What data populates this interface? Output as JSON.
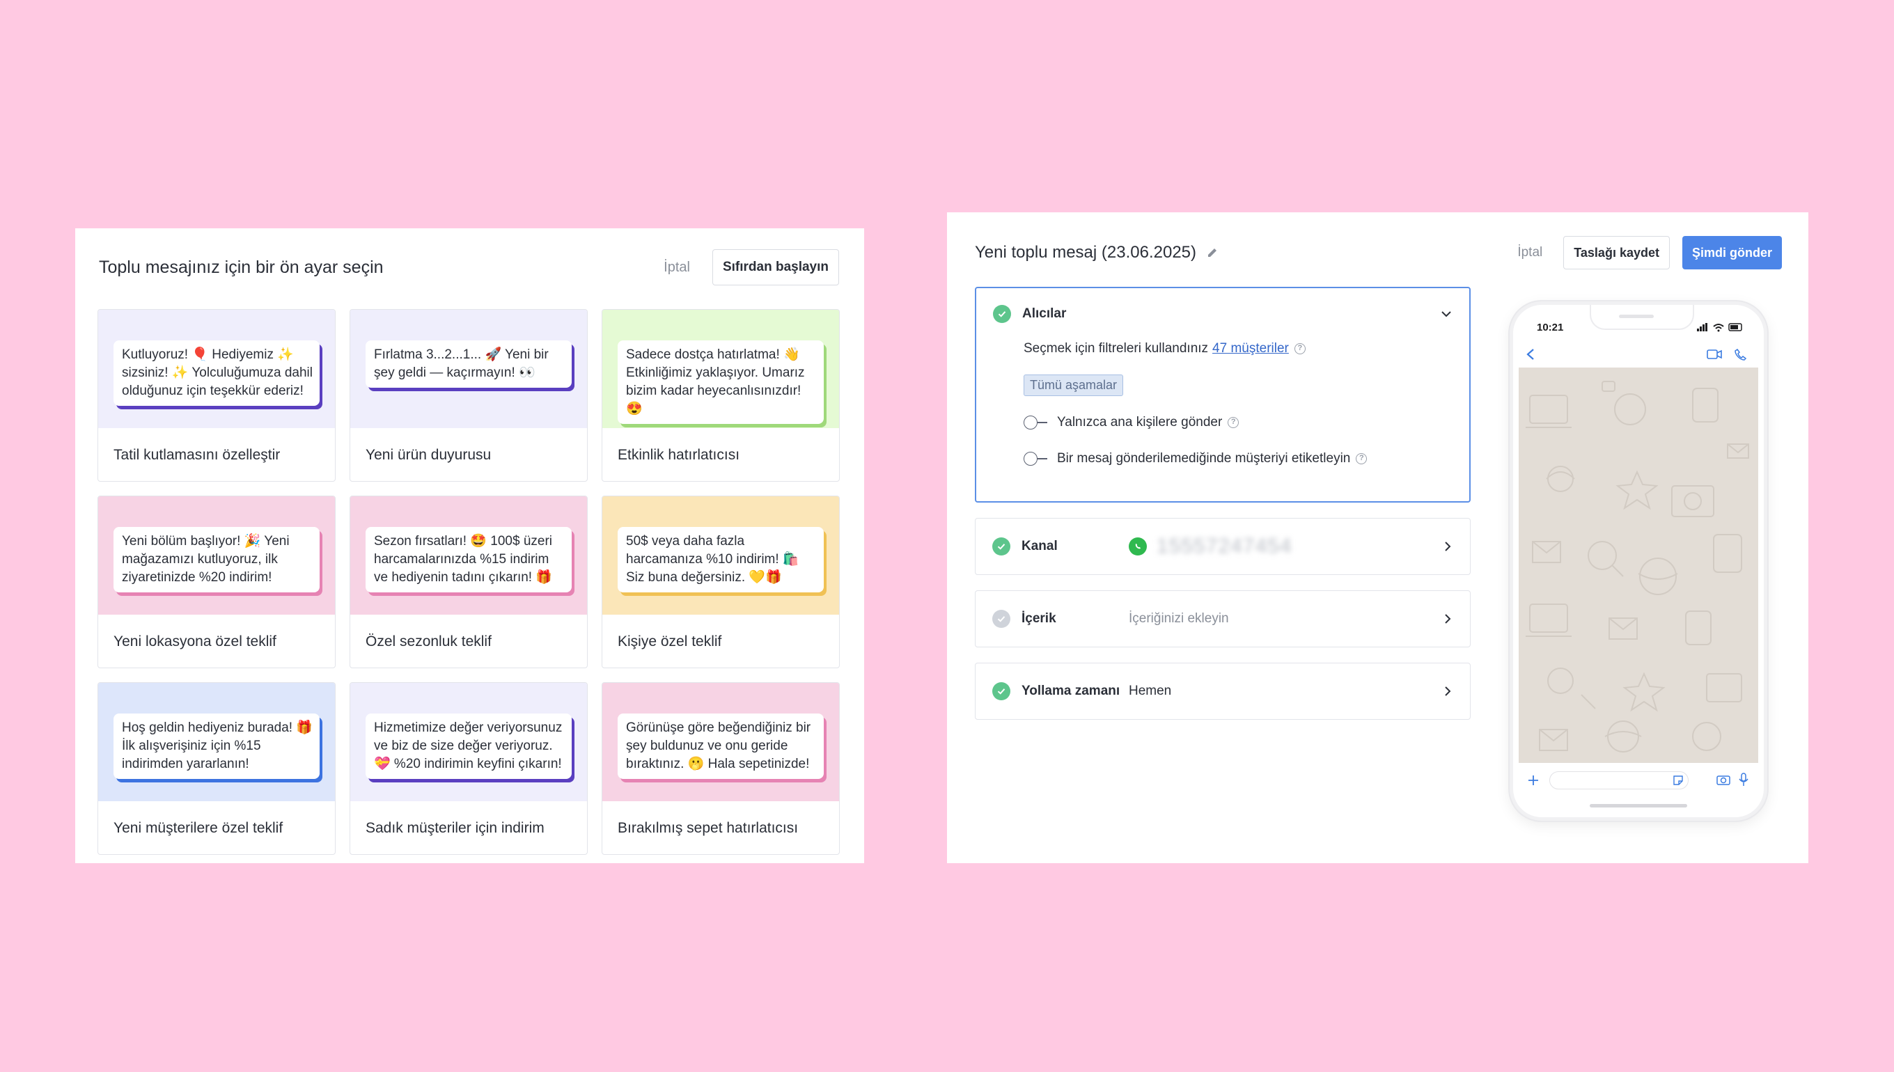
{
  "left": {
    "title": "Toplu mesajınız için bir ön ayar seçin",
    "cancel_label": "İptal",
    "start_blank_label": "Sıfırdan başlayın",
    "cards": [
      {
        "bubble": "Kutluyoruz! 🎈 Hediyemiz ✨ sizsiniz! ✨ Yolculuğumuza dahil olduğunuz için teşekkür ederiz!",
        "label": "Tatil kutlamasını özelleştir",
        "bg": "#efeefc",
        "accent": "#5a3fc0"
      },
      {
        "bubble": "Fırlatma 3...2...1... 🚀 Yeni bir şey geldi — kaçırmayın! 👀",
        "label": "Yeni ürün duyurusu",
        "bg": "#efeefc",
        "accent": "#5a3fc0"
      },
      {
        "bubble": "Sadece dostça hatırlatma! 👋 Etkinliğimiz yaklaşıyor. Umarız bizim kadar heyecanlısınızdır! 😍",
        "label": "Etkinlik hatırlatıcısı",
        "bg": "#e5fad4",
        "accent": "#9fd97a"
      },
      {
        "bubble": "Yeni bölüm başlıyor! 🎉 Yeni mağazamızı kutluyoruz, ilk ziyaretinizde %20 indirim!",
        "label": "Yeni lokasyona özel teklif",
        "bg": "#f7d3e4",
        "accent": "#e683b3"
      },
      {
        "bubble": "Sezon fırsatları! 🤩 100$ üzeri harcamalarınızda %15 indirim ve hediyenin tadını çıkarın! 🎁",
        "label": "Özel sezonluk teklif",
        "bg": "#f7d3e4",
        "accent": "#e683b3"
      },
      {
        "bubble": "50$ veya daha fazla harcamanıza %10 indirim! 🛍️ Siz buna değersiniz. 💛🎁",
        "label": "Kişiye özel teklif",
        "bg": "#fbe6b8",
        "accent": "#f0c154"
      },
      {
        "bubble": "Hoş geldin hediyeniz burada! 🎁 İlk alışverişiniz için %15 indirimden yararlanın!",
        "label": "Yeni müşterilere özel teklif",
        "bg": "#dde6fb",
        "accent": "#3d73e0"
      },
      {
        "bubble": "Hizmetimize değer veriyorsunuz ve biz de size değer veriyoruz. 💝 %20 indirimin keyfini çıkarın!",
        "label": "Sadık müşteriler için indirim",
        "bg": "#efeefc",
        "accent": "#5a3fc0"
      },
      {
        "bubble": "Görünüşe göre beğendiğiniz bir şey buldunuz ve onu geride bıraktınız. 🫢 Hala sepetinizde!",
        "label": "Bırakılmış sepet hatırlatıcısı",
        "bg": "#f7d3e4",
        "accent": "#e683b3"
      }
    ]
  },
  "right": {
    "title": "Yeni toplu mesaj (23.06.2025)",
    "cancel_label": "İptal",
    "draft_label": "Taslağı kaydet",
    "send_label": "Şimdi gönder",
    "recipients": {
      "label": "Alıcılar",
      "filter_text": "Seçmek için filtreleri kullandınız",
      "customers_link": "47 müşteriler",
      "stage_tag": "Tümü aşamalar",
      "toggle1": "Yalnızca ana kişilere gönder",
      "toggle2": "Bir mesaj gönderilemediğinde müşteriyi etiketleyin"
    },
    "channel": {
      "label": "Kanal",
      "value": "15557247454"
    },
    "content": {
      "label": "İçerik",
      "placeholder": "İçeriğinizi ekleyin"
    },
    "schedule": {
      "label": "Yollama zamanı",
      "value": "Hemen"
    },
    "phone": {
      "time": "10:21"
    }
  },
  "colors": {
    "background": "#ffc9e2",
    "primary": "#4c85e8",
    "success": "#5dc58c",
    "whatsapp": "#2fb94f"
  }
}
